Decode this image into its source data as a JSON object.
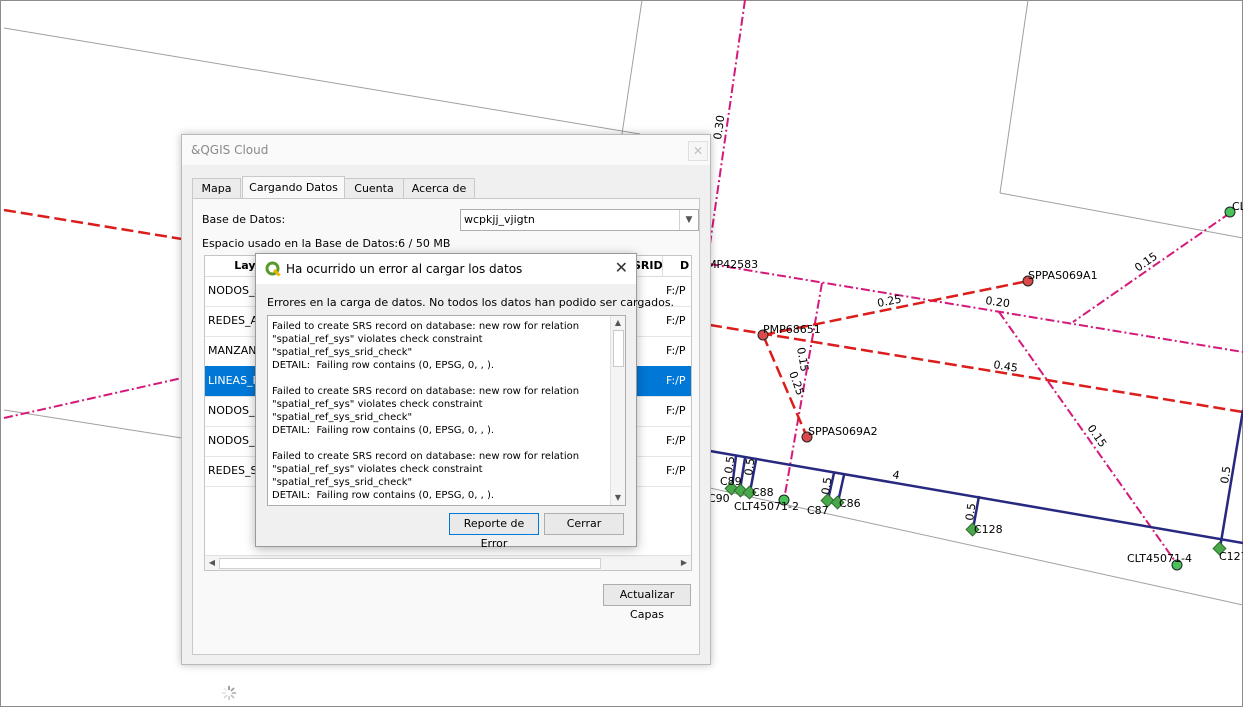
{
  "map": {
    "labels": {
      "d030": "0.30",
      "mp42583": "MP42583",
      "sppas069a1": "SPPAS069A1",
      "pmp68651": "PMP68651",
      "sppas069a2": "SPPAS069A2",
      "d025a": "0.25",
      "d020": "0.20",
      "d015a": "0.15",
      "d015b": "0.15",
      "d025b": "0.25",
      "d045": "0.45",
      "d015c": "0.15",
      "cl": "CL",
      "d05a": "0.5",
      "d05b": "0.5",
      "c89": "C89",
      "c90": "C90",
      "c88": "C88",
      "clt1": "CLT45071-2",
      "d05c": "0.5",
      "c87": "C87",
      "c86": "C86",
      "four": "4",
      "d05d": "0.5",
      "c128": "C128",
      "clt2": "CLT45071-4",
      "d05e": "0.5",
      "c127": "C127"
    },
    "colors": {
      "red": "#dd1c1c",
      "magenta": "#d5197a",
      "navy": "#27287f",
      "green": "#49a84a",
      "node_red": "#d94b4b"
    }
  },
  "cloud": {
    "title": "&QGIS Cloud",
    "close_icon": "close-icon",
    "tabs": [
      "Mapa",
      "Cargando Datos",
      "Cuenta",
      "Acerca de"
    ],
    "database_label": "Base de Datos:",
    "database_value": "wcpkjj_vjigtn",
    "space_used": "Espacio usado en la Base de Datos:6 / 50 MB",
    "columns": [
      "Laye",
      "SRID",
      "D"
    ],
    "rows": [
      {
        "layer": "NODOS_A",
        "d": "F:/P"
      },
      {
        "layer": "REDES_AC",
        "d": "F:/P"
      },
      {
        "layer": "MANZAN",
        "d": "F:/P"
      },
      {
        "layer": "LINEAS_P",
        "d": "F:/P"
      },
      {
        "layer": "NODOS_P",
        "d": "F:/P"
      },
      {
        "layer": "NODOS_S",
        "d": "F:/P"
      },
      {
        "layer": "REDES_SA",
        "d": "F:/P"
      }
    ],
    "selected_row": 3,
    "refresh_button": "Actualizar Capas"
  },
  "error": {
    "title": "Ha ocurrido un error al cargar los datos",
    "message": "Errores en la carga de datos. No todos los datos han podido ser cargados.",
    "details": "Failed to create SRS record on database: new row for relation \"spatial_ref_sys\" violates check constraint \"spatial_ref_sys_srid_check\"\nDETAIL:  Failing row contains (0, EPSG, 0, , ).\n\nFailed to create SRS record on database: new row for relation \"spatial_ref_sys\" violates check constraint \"spatial_ref_sys_srid_check\"\nDETAIL:  Failing row contains (0, EPSG, 0, , ).\n\nFailed to create SRS record on database: new row for relation \"spatial_ref_sys\" violates check constraint \"spatial_ref_sys_srid_check\"\nDETAIL:  Failing row contains (0, EPSG, 0, , ).",
    "report_button": "Reporte de Error",
    "close_button": "Cerrar"
  }
}
